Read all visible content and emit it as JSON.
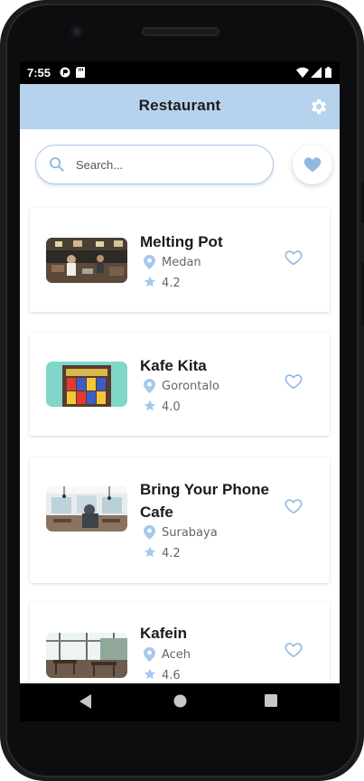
{
  "status": {
    "time": "7:55"
  },
  "appbar": {
    "title": "Restaurant",
    "settings_icon": "gear-icon"
  },
  "search": {
    "placeholder": "Search...",
    "value": ""
  },
  "favorites_icon": "heart-icon",
  "accent_color": "#b6d2ec",
  "icon_color": "#8fb9e3",
  "restaurants": [
    {
      "name": "Melting Pot",
      "city": "Medan",
      "rating": "4.2"
    },
    {
      "name": "Kafe Kita",
      "city": "Gorontalo",
      "rating": "4.0"
    },
    {
      "name": "Bring Your Phone Cafe",
      "city": "Surabaya",
      "rating": "4.2"
    },
    {
      "name": "Kafein",
      "city": "Aceh",
      "rating": "4.6"
    }
  ]
}
